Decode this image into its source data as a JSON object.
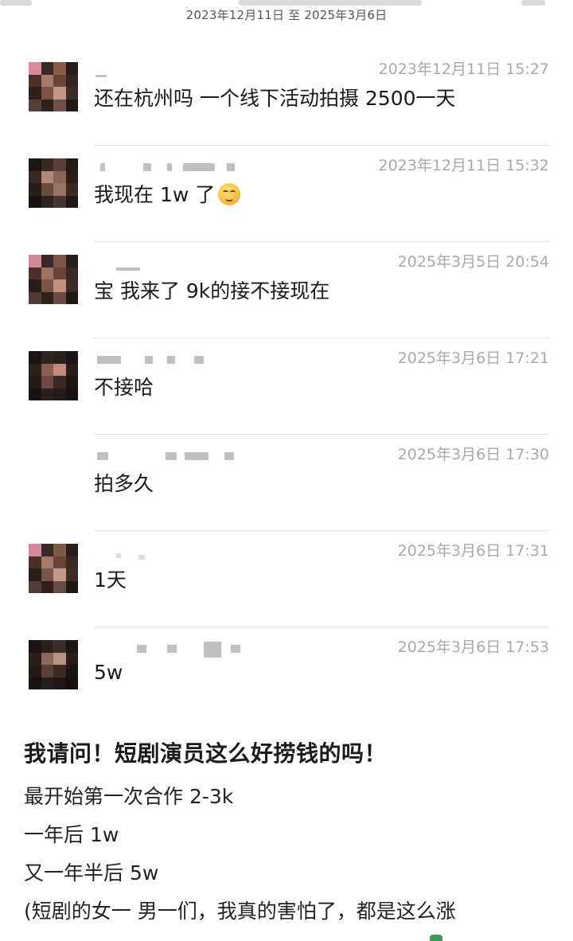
{
  "header": {
    "date_range": "2023年12月11日 至 2025年3月6日"
  },
  "messages": [
    {
      "time": "2023年12月11日 15:27",
      "text": "还在杭州吗 一个线下活动拍摄 2500一天"
    },
    {
      "time": "2023年12月11日 15:32",
      "text": "我现在 1w 了",
      "emoji": "grinning-squint-face"
    },
    {
      "time": "2025年3月5日 20:54",
      "text": "宝 我来了 9k的接不接现在"
    },
    {
      "time": "2025年3月6日 17:21",
      "text": "不接哈"
    },
    {
      "time": "2025年3月6日 17:30",
      "text": "拍多久"
    },
    {
      "time": "2025年3月6日 17:31",
      "text": "1天"
    },
    {
      "time": "2025年3月6日 17:53",
      "text": "5w"
    }
  ],
  "post": {
    "title": "我请问！短剧演员这么好捞钱的吗！",
    "lines": [
      "最开始第一次合作 2-3k",
      "一年后 1w",
      "又一年半后 5w",
      "(短剧的女一 男一们，我真的害怕了，都是这么涨"
    ]
  }
}
